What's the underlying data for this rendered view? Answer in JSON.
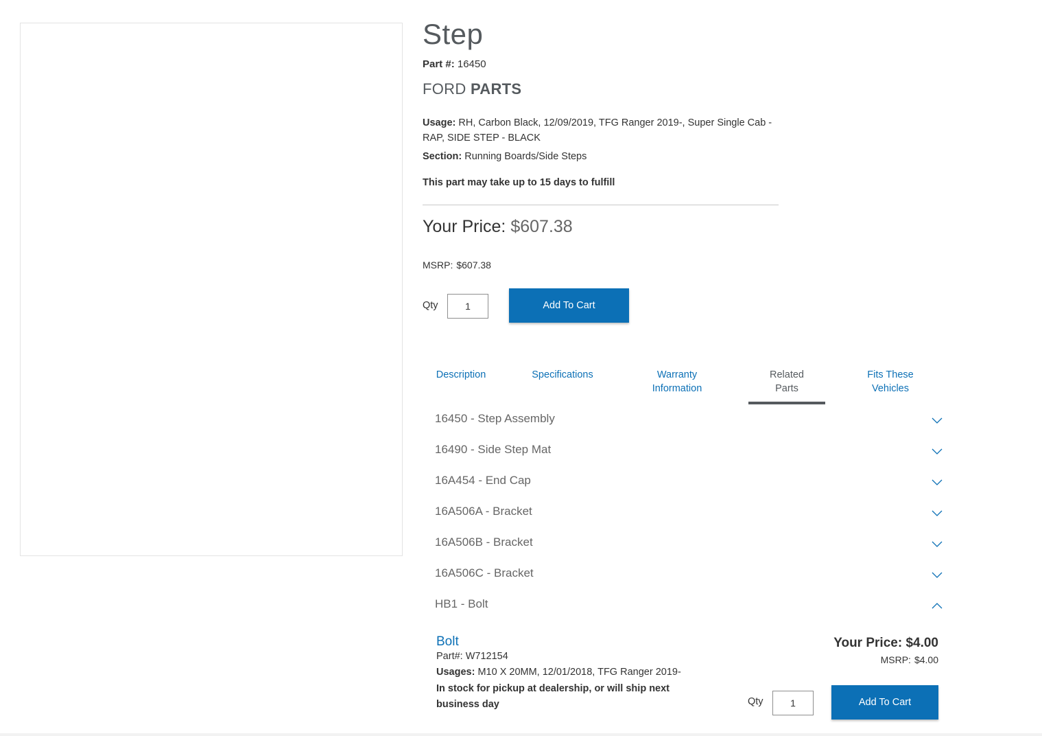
{
  "product": {
    "title": "Step",
    "part_label": "Part #:",
    "part_number": "16450",
    "brand_light": "FORD",
    "brand_bold": "PARTS",
    "usage_label": "Usage:",
    "usage_text": "RH, Carbon Black, 12/09/2019, TFG Ranger 2019-, Super Single Cab - RAP, SIDE STEP - BLACK",
    "section_label": "Section:",
    "section_text": "Running Boards/Side Steps",
    "fulfill_note": "This part may take up to 15 days to fulfill",
    "price_label": "Your Price:",
    "price_value": "$607.38",
    "msrp_label": "MSRP:",
    "msrp_value": "$607.38",
    "qty_label": "Qty",
    "qty_value": "1",
    "add_to_cart": "Add To Cart"
  },
  "tabs": [
    {
      "line1": "Description",
      "line2": ""
    },
    {
      "line1": "Specifications",
      "line2": ""
    },
    {
      "line1": "Warranty",
      "line2": "Information"
    },
    {
      "line1": "Related",
      "line2": "Parts"
    },
    {
      "line1": "Fits These",
      "line2": "Vehicles"
    }
  ],
  "active_tab": "Related Parts",
  "related_parts": [
    {
      "label": "16450 - Step Assembly",
      "expanded": false
    },
    {
      "label": "16490 - Side Step Mat",
      "expanded": false
    },
    {
      "label": "16A454 - End Cap",
      "expanded": false
    },
    {
      "label": "16A506A - Bracket",
      "expanded": false
    },
    {
      "label": "16A506B - Bracket",
      "expanded": false
    },
    {
      "label": "16A506C - Bracket",
      "expanded": false
    },
    {
      "label": "HB1 - Bolt",
      "expanded": true
    }
  ],
  "expanded_item": {
    "name": "Bolt",
    "part_label": "Part#:",
    "part_number": "W712154",
    "usage_label": "Usages:",
    "usage_text": "M10 X 20MM, 12/01/2018, TFG Ranger 2019-",
    "stock_note": "In stock for pickup at dealership, or will ship next business day",
    "price_label": "Your Price:",
    "price_value": "$4.00",
    "msrp_label": "MSRP:",
    "msrp_value": "$4.00",
    "qty_label": "Qty",
    "qty_value": "1",
    "add_to_cart": "Add To Cart"
  },
  "colors": {
    "accent": "#0c70b6",
    "title_gray": "#555a5e"
  }
}
